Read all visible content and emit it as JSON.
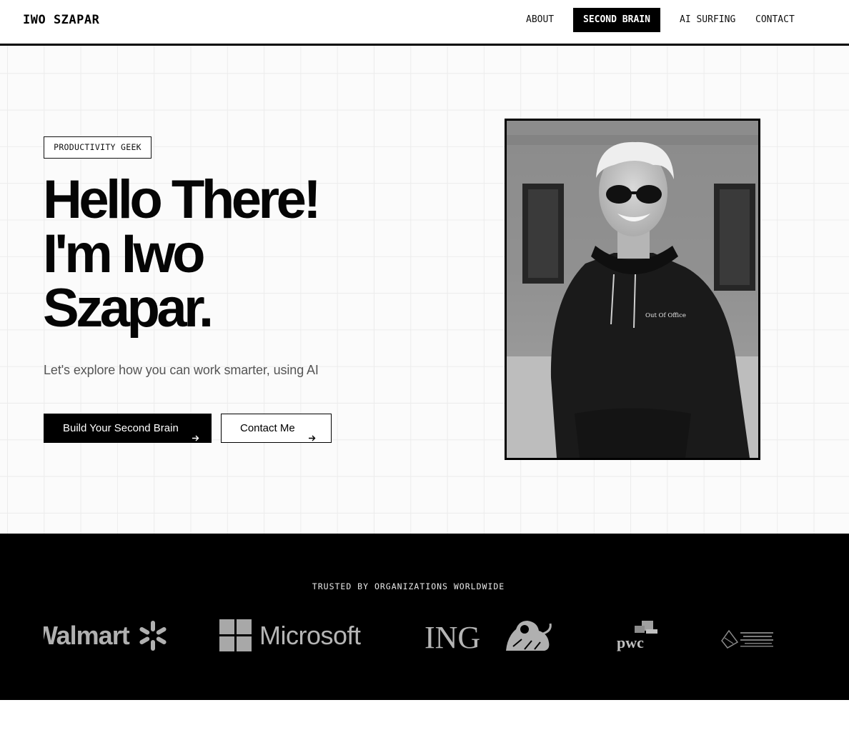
{
  "nav": {
    "brand": "IWO SZAPAR",
    "links": [
      {
        "label": "ABOUT",
        "active": false
      },
      {
        "label": "SECOND BRAIN",
        "active": true
      },
      {
        "label": "AI SURFING",
        "active": false
      },
      {
        "label": "CONTACT",
        "active": false
      }
    ]
  },
  "hero": {
    "tag": "PRODUCTIVITY GEEK",
    "headline": [
      "Hello There!",
      "I'm Iwo",
      "Szapar."
    ],
    "subtitle": "Let's explore how you can work smarter, using AI",
    "primary_button": "Build Your Second Brain",
    "secondary_button": "Contact Me",
    "photo_caption_print": "Out Of Office"
  },
  "trusted": {
    "heading": "TRUSTED BY ORGANIZATIONS WORLDWIDE",
    "logos": [
      "Walmart",
      "Microsoft",
      "ING",
      "pwc"
    ]
  },
  "colors": {
    "ink": "#000000",
    "background": "#ffffff",
    "grid": "#ececec",
    "logo_gray": "#b0b0b0"
  },
  "icons": {
    "button_arrow": "arrow-right-icon"
  }
}
